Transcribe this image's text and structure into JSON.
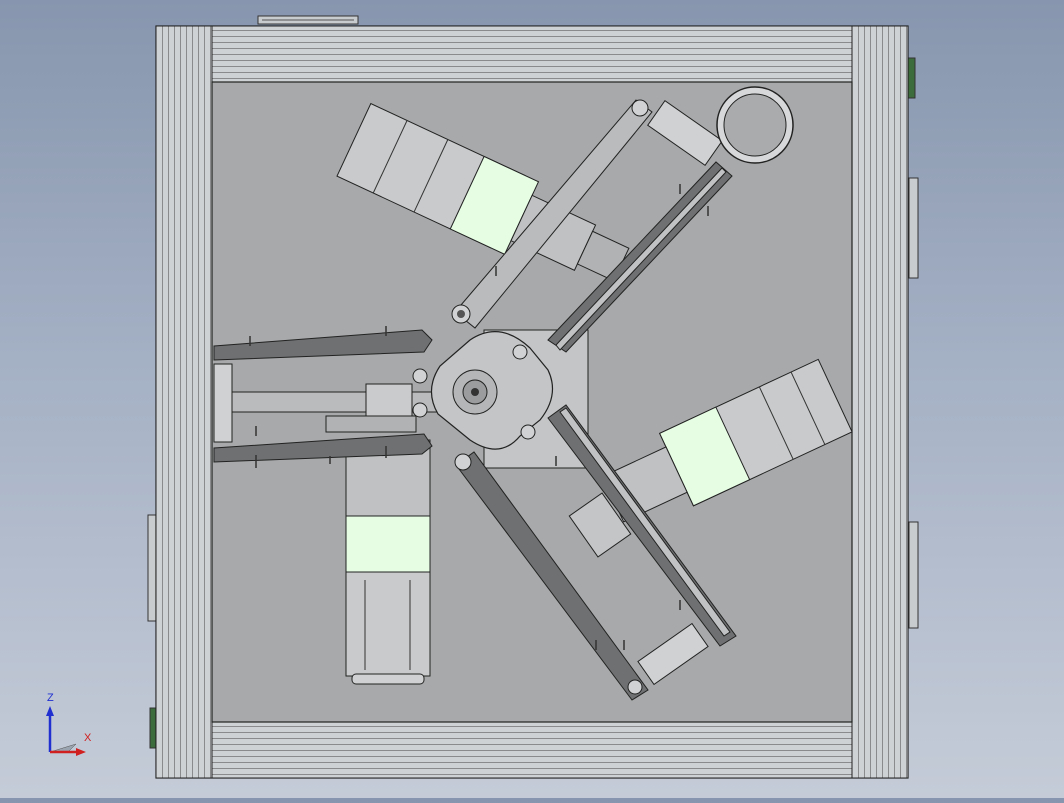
{
  "colors": {
    "background_top": "#8796ae",
    "background_bottom": "#c5ccd8",
    "frame": "#cdd0d3",
    "plate": "#a6a8a9",
    "motor_label": "#e6fde4",
    "edge": "#2b2b2b",
    "axis_z": "#2030d0",
    "axis_x": "#d02020"
  },
  "triad": {
    "z_label": "Z",
    "x_label": "X"
  }
}
